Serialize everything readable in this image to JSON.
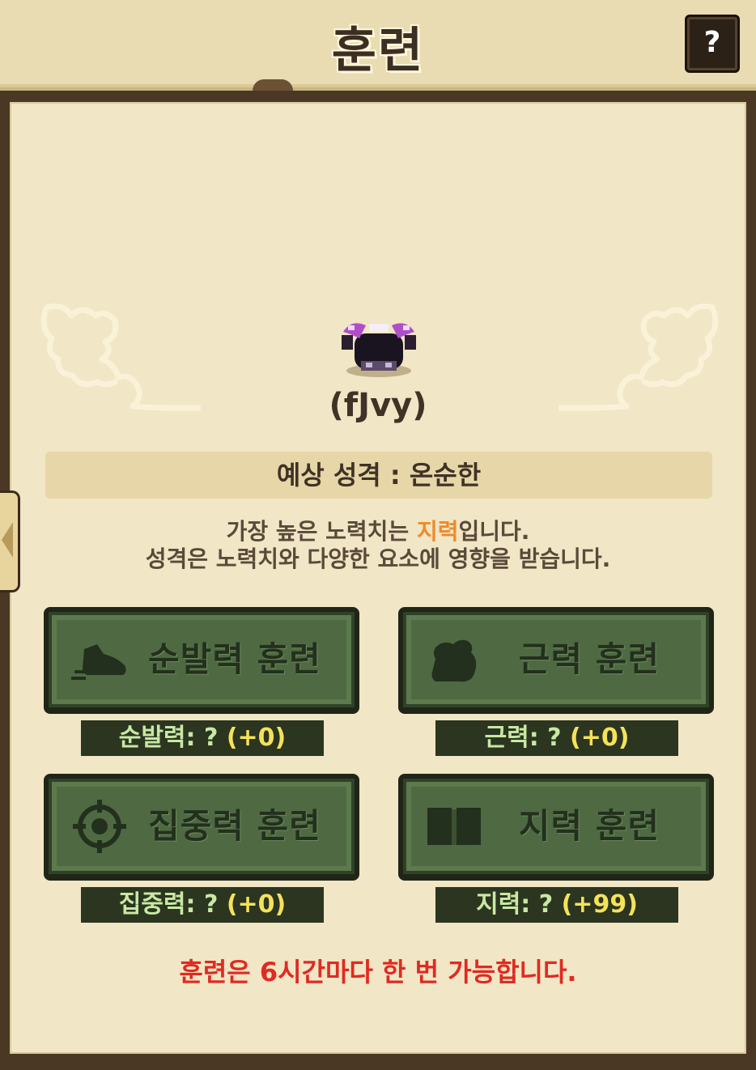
{
  "header": {
    "title": "훈련",
    "help_label": "?"
  },
  "creature": {
    "name": "(fJvy)"
  },
  "personality": "예상 성격 : 온순한",
  "info": {
    "line1_prefix": "가장 높은 노력치는 ",
    "line1_highlight": "지력",
    "line1_suffix": "입니다.",
    "line2": "성격은 노력치와 다양한 요소에 영향을 받습니다."
  },
  "training": [
    {
      "label": "순발력 훈련",
      "icon": "shoe-icon",
      "stat_label": "순발력: ? ",
      "stat_bonus": "(+0)"
    },
    {
      "label": "근력 훈련",
      "icon": "muscle-arm-icon",
      "stat_label": "근력: ? ",
      "stat_bonus": "(+0)"
    },
    {
      "label": "집중력 훈련",
      "icon": "crosshair-icon",
      "stat_label": "집중력: ? ",
      "stat_bonus": "(+0)"
    },
    {
      "label": "지력 훈련",
      "icon": "book-icon",
      "stat_label": "지력: ? ",
      "stat_bonus": "(+99)"
    }
  ],
  "notice": "훈련은 6시간마다 한 번 가능합니다.",
  "colors": {
    "highlight": "#f08a2a",
    "notice": "#e02a22",
    "button_green": "#4f6a42",
    "stat_text": "#c8e8a3"
  }
}
